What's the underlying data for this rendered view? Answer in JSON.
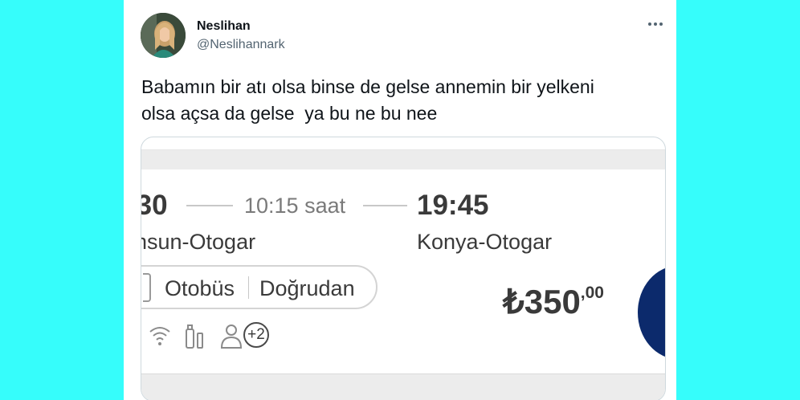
{
  "tweet": {
    "author_name": "Neslihan",
    "author_handle": "@Neslihannark",
    "text": "Babamın bir atı olsa binse de gelse annemin bir yelkeni\nolsa açsa da gelse  ya bu ne bu nee"
  },
  "ticket": {
    "departure_time": ":30",
    "duration": "10:15 saat",
    "arrival_time": "19:45",
    "departure_place": "nsun-Otogar",
    "arrival_place": "Konya-Otogar",
    "vehicle_type": "Otobüs",
    "route_type": "Doğrudan",
    "price_main": "₺350",
    "price_cents": ",00",
    "amenities": [
      "wifi-icon",
      "bottle-icon",
      "seat-person-icon"
    ],
    "more_amenities": "+2",
    "accent_color": "#0c2a6c"
  },
  "colors": {
    "background": "#36fdfb",
    "card": "#ffffff",
    "text_primary": "#0f1419",
    "text_secondary": "#536471"
  }
}
